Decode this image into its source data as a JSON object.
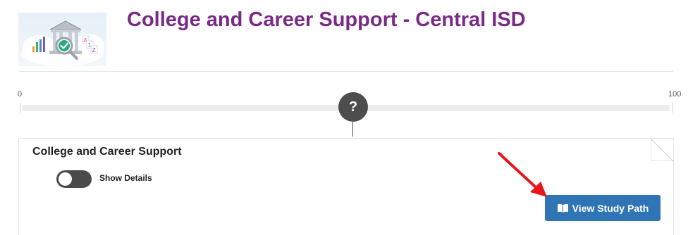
{
  "header": {
    "title": "College and Career Support - Central ISD",
    "logo_text": "A 1 Z"
  },
  "slider": {
    "min_label": "0",
    "max_label": "100",
    "handle_label": "?"
  },
  "card": {
    "title": "College and Career Support",
    "toggle": {
      "label": "Show Details",
      "on": false
    },
    "button": {
      "label": "View Study Path",
      "icon": "book-icon"
    }
  },
  "colors": {
    "title": "#7a2a86",
    "button": "#2f74b5",
    "slider_handle": "#4d4d4d",
    "annotation_arrow": "#e8151b"
  }
}
